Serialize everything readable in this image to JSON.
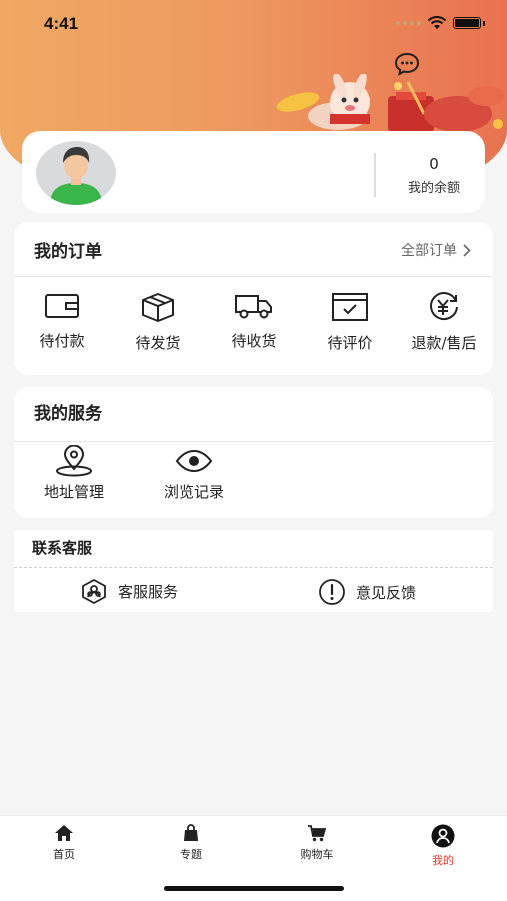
{
  "status_bar": {
    "time": "4:41"
  },
  "profile": {
    "balance_value": "0",
    "balance_label": "我的余额"
  },
  "orders": {
    "title": "我的订单",
    "all_orders": "全部订单",
    "items": [
      {
        "label": "待付款",
        "icon": "wallet-icon"
      },
      {
        "label": "待发货",
        "icon": "box-icon"
      },
      {
        "label": "待收货",
        "icon": "truck-icon"
      },
      {
        "label": "待评价",
        "icon": "review-icon"
      },
      {
        "label": "退款/售后",
        "icon": "refund-icon"
      }
    ]
  },
  "services": {
    "title": "我的服务",
    "items": [
      {
        "label": "地址管理",
        "icon": "location-pin-icon"
      },
      {
        "label": "浏览记录",
        "icon": "eye-icon"
      }
    ]
  },
  "contact": {
    "title": "联系客服",
    "items": [
      {
        "label": "客服服务",
        "icon": "customer-service-icon"
      },
      {
        "label": "意见反馈",
        "icon": "feedback-icon"
      }
    ]
  },
  "tabbar": {
    "items": [
      {
        "label": "首页",
        "icon": "home-icon"
      },
      {
        "label": "专题",
        "icon": "bag-icon"
      },
      {
        "label": "购物车",
        "icon": "cart-icon"
      },
      {
        "label": "我的",
        "icon": "user-icon",
        "active": true
      }
    ],
    "active_color": "#e53b2c"
  },
  "colors": {
    "header_start": "#f0a862",
    "header_end": "#e8724f",
    "accent": "#e53b2c"
  }
}
